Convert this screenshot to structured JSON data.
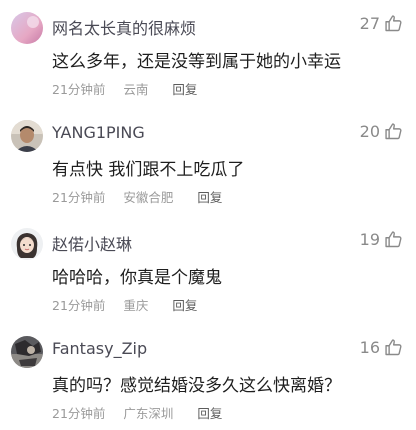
{
  "comments": [
    {
      "username": "网名太长真的很麻烦",
      "likes": "27",
      "content": "这么多年，还是没等到属于她的小幸运",
      "time": "21分钟前",
      "location": "云南",
      "reply_label": "回复",
      "avatar_icon": "avatar-pink-gradient"
    },
    {
      "username": "YANG1PING",
      "likes": "20",
      "content": "有点快 我们跟不上吃瓜了",
      "time": "21分钟前",
      "location": "安徽合肥",
      "reply_label": "回复",
      "avatar_icon": "avatar-person-photo"
    },
    {
      "username": "赵偌小赵琳",
      "likes": "19",
      "content": "哈哈哈，你真是个魔鬼",
      "time": "21分钟前",
      "location": "重庆",
      "reply_label": "回复",
      "avatar_icon": "avatar-girl-cartoon"
    },
    {
      "username": "Fantasy_Zip",
      "likes": "16",
      "content": "真的吗？感觉结婚没多久这么快离婚？",
      "time": "21分钟前",
      "location": "广东深圳",
      "reply_label": "回复",
      "avatar_icon": "avatar-dark-photo"
    }
  ],
  "colors": {
    "username": "#4a4a55",
    "content": "#1e1e1e",
    "meta": "#9a9a9a",
    "like_count": "#8a8a8a"
  }
}
